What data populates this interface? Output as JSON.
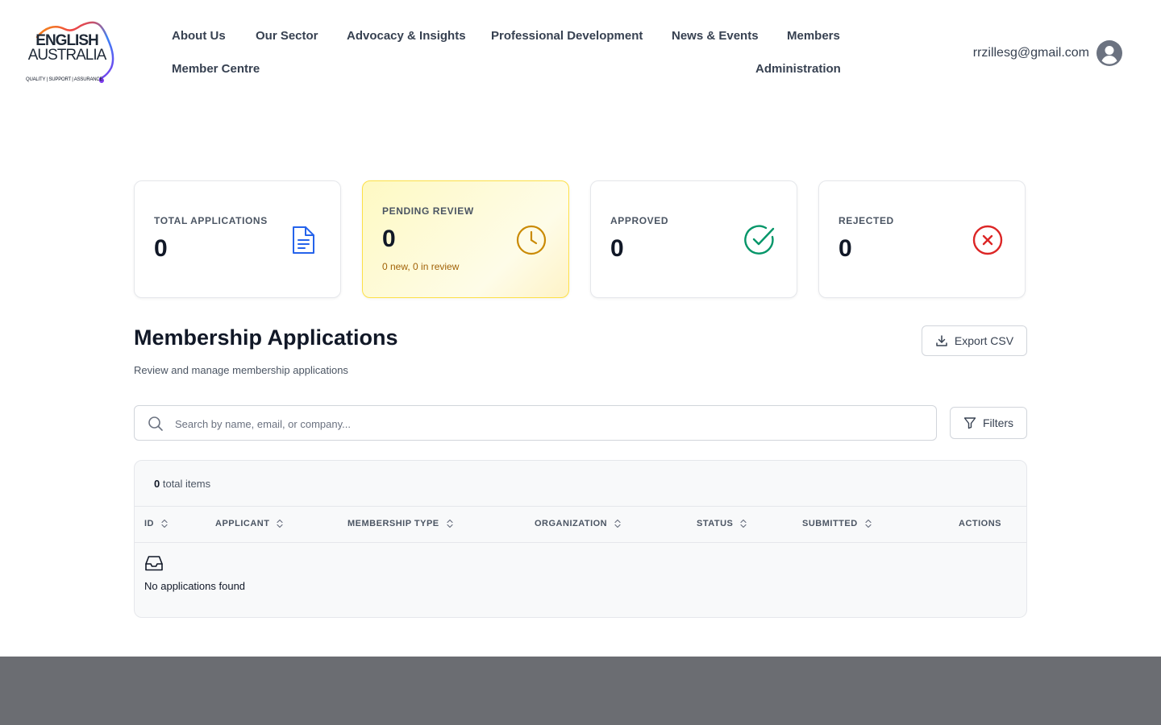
{
  "brand": {
    "line1": "ENGLISH",
    "line2": "AUSTRALIA",
    "tagline": "QUALITY | SUPPORT | ASSURANCE"
  },
  "nav": {
    "about": "About Us",
    "sector": "Our Sector",
    "advocacy": "Advocacy & Insights",
    "professional": "Professional Development",
    "news": "News & Events",
    "members": "Members",
    "member_centre": "Member Centre",
    "administration": "Administration"
  },
  "user": {
    "email": "rrzillesg@gmail.com",
    "avatar_icon": "user-circle-icon"
  },
  "stats": {
    "total": {
      "label": "TOTAL APPLICATIONS",
      "value": "0",
      "icon": "document-icon",
      "color": "#2563eb"
    },
    "pending": {
      "label": "PENDING REVIEW",
      "value": "0",
      "sub": "0 new, 0 in review",
      "icon": "clock-icon",
      "color": "#ca8a04"
    },
    "approved": {
      "label": "APPROVED",
      "value": "0",
      "icon": "check-circle-icon",
      "color": "#059669"
    },
    "rejected": {
      "label": "REJECTED",
      "value": "0",
      "icon": "x-circle-icon",
      "color": "#dc2626"
    }
  },
  "section": {
    "title": "Membership Applications",
    "subtitle": "Review and manage membership applications",
    "export_label": "Export CSV",
    "filters_label": "Filters"
  },
  "search": {
    "placeholder": "Search by name, email, or company...",
    "value": ""
  },
  "table": {
    "count": "0",
    "count_suffix": " total items",
    "columns": [
      "ID",
      "APPLICANT",
      "MEMBERSHIP TYPE",
      "ORGANIZATION",
      "STATUS",
      "SUBMITTED",
      "ACTIONS"
    ],
    "rows": [],
    "empty_text": "No applications found"
  }
}
